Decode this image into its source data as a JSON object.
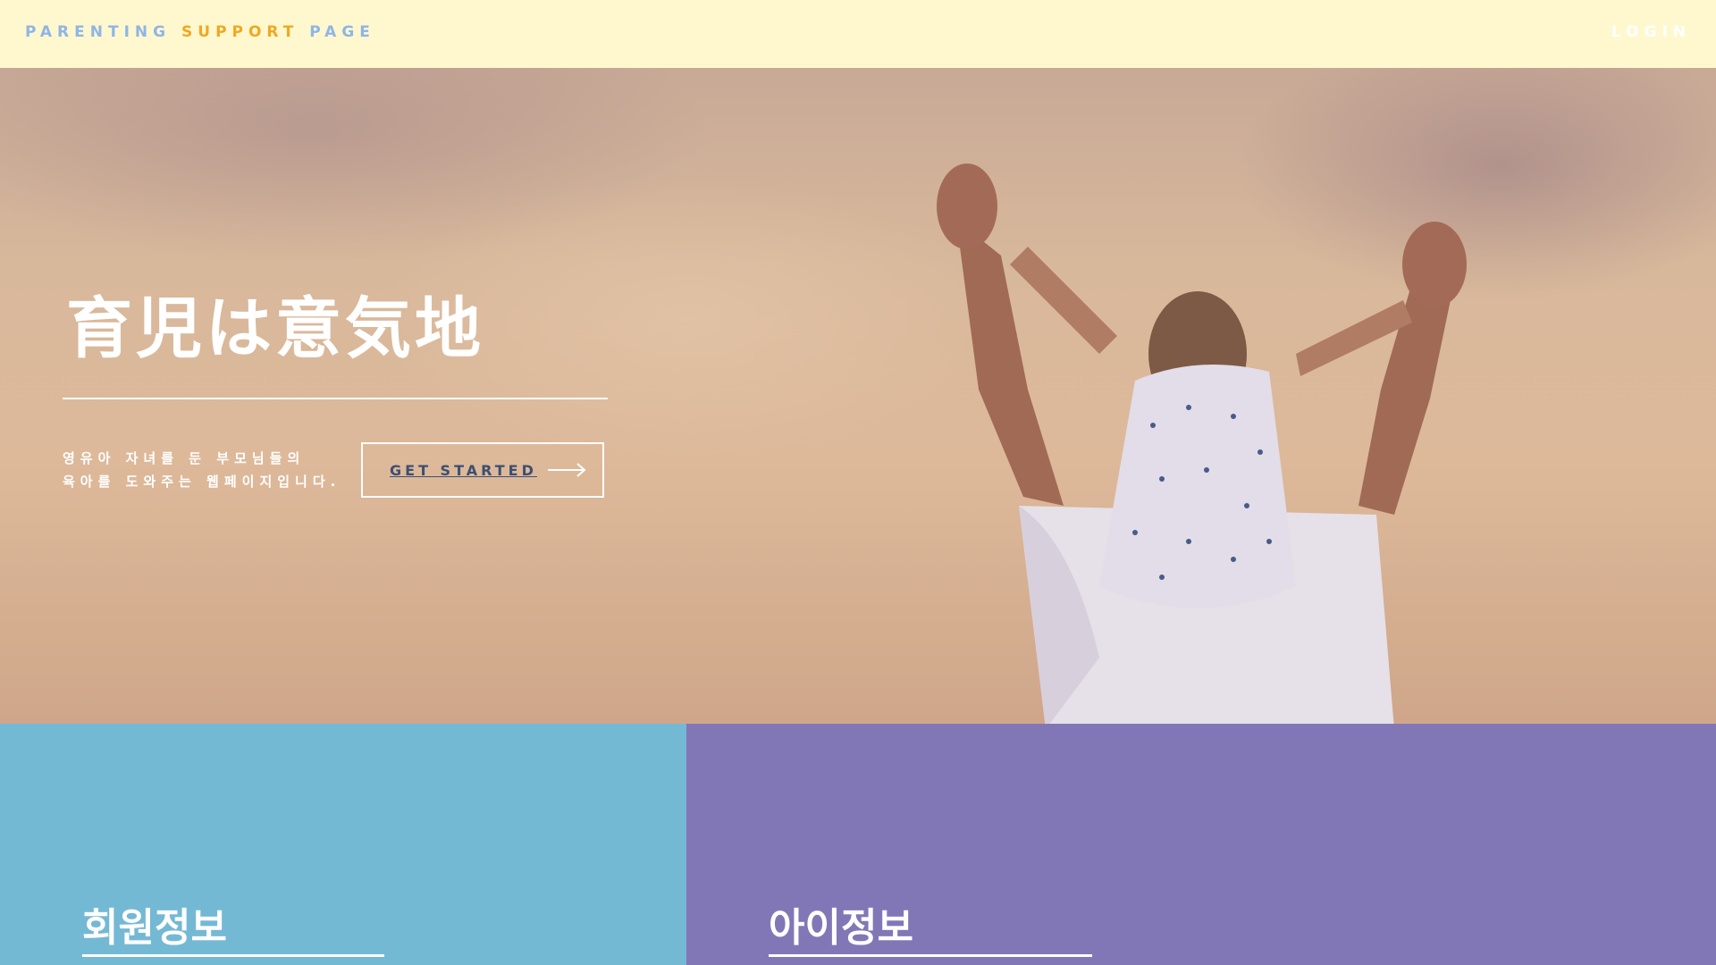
{
  "header": {
    "brand_word1": "PARENTING",
    "brand_word2": "SUPPORT",
    "brand_word3": "PAGE",
    "login_label": "LOGIN"
  },
  "hero": {
    "title": "育児は意気地",
    "description_line1": "영유아 자녀를 둔 부모님들의",
    "description_line2": "육아를 도와주는 웹페이지입니다.",
    "cta_label": "GET STARTED",
    "cta_icon": "arrow-right-icon",
    "image_subject": "adult-carrying-child-on-shoulders-photo"
  },
  "panels": [
    {
      "title": "회원정보",
      "color": "#74b9d4"
    },
    {
      "title": "아이정보",
      "color": "#8277b6"
    }
  ],
  "colors": {
    "header_bg": "#fff8cf",
    "brand_blue": "#8fb5e6",
    "brand_orange": "#f0a821",
    "cta_text": "#3c4f72"
  }
}
